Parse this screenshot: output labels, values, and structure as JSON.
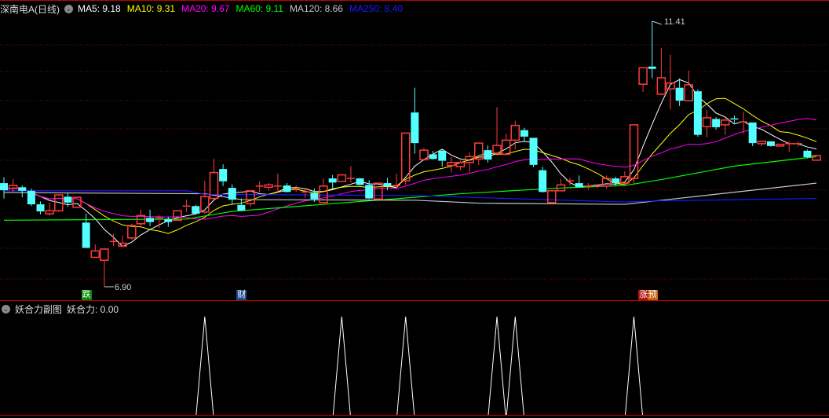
{
  "header": {
    "title": "深南电A(日线)",
    "ma": [
      {
        "label": "MA5: 9.18",
        "color": "#ffffff"
      },
      {
        "label": "MA10: 9.31",
        "color": "#ffff00"
      },
      {
        "label": "MA20: 9.67",
        "color": "#ff00ff"
      },
      {
        "label": "MA60: 9.11",
        "color": "#00ff00"
      },
      {
        "label": "MA120: 8.66",
        "color": "#c8c8c8"
      },
      {
        "label": "MA250: 8.40",
        "color": "#1a1aff"
      }
    ]
  },
  "sub_header": {
    "title": "妖合力副图",
    "value_label": "妖合力: 0.00"
  },
  "markers": {
    "high_label": "11.41",
    "low_label": "6.90",
    "signals": [
      {
        "index": 9,
        "text": "跌",
        "bg": "#0a8a0a"
      },
      {
        "index": 26,
        "text": "财",
        "bg": "#1a4a8a"
      },
      {
        "index": 70,
        "text": "涨",
        "bg": "#b01010"
      },
      {
        "index": 71,
        "text": "预",
        "bg": "#c86010"
      }
    ]
  },
  "colors": {
    "up": "#ff3b3b",
    "down": "#54ffff",
    "grid": "#6a0f0f",
    "divider": "#c00000"
  },
  "chart_data": {
    "type": "candlestick",
    "title": "深南电A(日线)",
    "ylim": [
      6.9,
      11.41
    ],
    "ohlc": [
      [
        8.66,
        8.76,
        8.4,
        8.54
      ],
      [
        8.57,
        8.73,
        8.49,
        8.62
      ],
      [
        8.59,
        8.62,
        8.42,
        8.53
      ],
      [
        8.53,
        8.57,
        8.27,
        8.3
      ],
      [
        8.3,
        8.35,
        8.13,
        8.18
      ],
      [
        8.14,
        8.33,
        8.11,
        8.19
      ],
      [
        8.19,
        8.46,
        8.17,
        8.46
      ],
      [
        8.43,
        8.5,
        8.26,
        8.33
      ],
      [
        8.25,
        8.42,
        8.25,
        8.42
      ],
      [
        7.99,
        8.14,
        7.56,
        7.56
      ],
      [
        7.4,
        7.62,
        7.4,
        7.51
      ],
      [
        7.35,
        7.56,
        6.9,
        7.54
      ],
      [
        7.67,
        7.8,
        7.59,
        7.67
      ],
      [
        7.59,
        7.77,
        7.57,
        7.64
      ],
      [
        7.73,
        7.97,
        7.7,
        7.94
      ],
      [
        7.97,
        8.21,
        7.9,
        8.11
      ],
      [
        8.07,
        8.21,
        7.93,
        8.0
      ],
      [
        8.05,
        8.11,
        7.9,
        8.07
      ],
      [
        8.05,
        8.09,
        7.92,
        8.0
      ],
      [
        8.03,
        8.19,
        8.02,
        8.19
      ],
      [
        8.25,
        8.38,
        8.17,
        8.27
      ],
      [
        8.27,
        8.29,
        8.13,
        8.14
      ],
      [
        8.17,
        8.7,
        8.14,
        8.43
      ],
      [
        8.4,
        9.07,
        8.4,
        8.84
      ],
      [
        8.9,
        8.98,
        8.61,
        8.69
      ],
      [
        8.58,
        8.64,
        8.3,
        8.38
      ],
      [
        8.29,
        8.4,
        8.19,
        8.19
      ],
      [
        8.31,
        8.53,
        8.26,
        8.53
      ],
      [
        8.61,
        8.69,
        8.5,
        8.61
      ],
      [
        8.59,
        8.66,
        8.53,
        8.63
      ],
      [
        8.61,
        8.82,
        8.5,
        8.61
      ],
      [
        8.62,
        8.66,
        8.5,
        8.51
      ],
      [
        8.57,
        8.62,
        8.51,
        8.57
      ],
      [
        8.49,
        8.57,
        8.41,
        8.51
      ],
      [
        8.49,
        8.57,
        8.34,
        8.39
      ],
      [
        8.33,
        8.74,
        8.33,
        8.61
      ],
      [
        8.74,
        8.8,
        8.57,
        8.67
      ],
      [
        8.69,
        8.8,
        8.69,
        8.8
      ],
      [
        8.74,
        8.95,
        8.67,
        8.74
      ],
      [
        8.74,
        8.75,
        8.62,
        8.63
      ],
      [
        8.63,
        8.71,
        8.39,
        8.4
      ],
      [
        8.39,
        8.66,
        8.39,
        8.66
      ],
      [
        8.66,
        8.75,
        8.54,
        8.61
      ],
      [
        8.62,
        8.82,
        8.57,
        8.62
      ],
      [
        8.7,
        9.51,
        8.63,
        9.51
      ],
      [
        9.86,
        10.28,
        9.16,
        9.34
      ],
      [
        9.06,
        9.26,
        9.04,
        9.22
      ],
      [
        9.15,
        9.21,
        9.06,
        9.07
      ],
      [
        9.21,
        9.23,
        8.94,
        9.04
      ],
      [
        8.96,
        9.1,
        8.84,
        9.01
      ],
      [
        8.94,
        9.04,
        8.88,
        9.01
      ],
      [
        9.01,
        9.18,
        8.84,
        9.11
      ],
      [
        9.07,
        9.34,
        8.97,
        9.34
      ],
      [
        9.22,
        9.3,
        9.01,
        9.06
      ],
      [
        9.17,
        9.95,
        9.13,
        9.3
      ],
      [
        9.15,
        9.5,
        9.13,
        9.39
      ],
      [
        9.39,
        9.72,
        9.23,
        9.64
      ],
      [
        9.56,
        9.6,
        9.37,
        9.45
      ],
      [
        9.43,
        9.43,
        8.93,
        8.97
      ],
      [
        8.88,
        8.94,
        8.5,
        8.51
      ],
      [
        8.33,
        8.53,
        8.33,
        8.53
      ],
      [
        8.53,
        8.73,
        8.53,
        8.63
      ],
      [
        8.7,
        8.75,
        8.62,
        8.7
      ],
      [
        8.66,
        8.79,
        8.59,
        8.59
      ],
      [
        8.61,
        8.66,
        8.55,
        8.61
      ],
      [
        8.59,
        8.63,
        8.57,
        8.61
      ],
      [
        8.61,
        8.79,
        8.57,
        8.74
      ],
      [
        8.74,
        8.77,
        8.62,
        8.66
      ],
      [
        8.66,
        8.86,
        8.62,
        8.77
      ],
      [
        8.74,
        9.65,
        8.63,
        9.65
      ],
      [
        10.34,
        10.62,
        10.21,
        10.62
      ],
      [
        10.64,
        11.41,
        10.44,
        10.6
      ],
      [
        10.17,
        10.96,
        10.17,
        10.45
      ],
      [
        10.26,
        10.84,
        9.91,
        10.36
      ],
      [
        10.28,
        10.44,
        9.97,
        10.06
      ],
      [
        10.06,
        10.57,
        10.06,
        10.33
      ],
      [
        10.22,
        10.25,
        9.45,
        9.48
      ],
      [
        9.62,
        9.9,
        9.44,
        9.77
      ],
      [
        9.75,
        9.78,
        9.57,
        9.61
      ],
      [
        9.65,
        9.79,
        9.48,
        9.73
      ],
      [
        9.75,
        9.81,
        9.68,
        9.73
      ],
      [
        9.68,
        9.87,
        9.5,
        9.7
      ],
      [
        9.69,
        9.69,
        9.29,
        9.34
      ],
      [
        9.33,
        9.37,
        9.29,
        9.37
      ],
      [
        9.37,
        9.37,
        9.28,
        9.29
      ],
      [
        9.29,
        9.32,
        9.29,
        9.32
      ],
      [
        9.33,
        9.37,
        9.19,
        9.33
      ],
      [
        9.33,
        9.37,
        9.28,
        9.33
      ],
      [
        9.21,
        9.23,
        9.08,
        9.1
      ],
      [
        9.05,
        9.13,
        9.05,
        9.13
      ]
    ],
    "ma_computed": [
      {
        "name": "MA5",
        "period": 5,
        "color": "#ffffff"
      },
      {
        "name": "MA10",
        "period": 10,
        "color": "#ffff00"
      },
      {
        "name": "MA20",
        "period": 20,
        "color": "#ff00ff"
      }
    ],
    "ma_keypoints": [
      {
        "name": "MA60",
        "color": "#00ff00",
        "points": [
          [
            0,
            8.03
          ],
          [
            20,
            8.05
          ],
          [
            25,
            8.18
          ],
          [
            35,
            8.3
          ],
          [
            50,
            8.48
          ],
          [
            60,
            8.57
          ],
          [
            68,
            8.62
          ],
          [
            72,
            8.72
          ],
          [
            80,
            8.95
          ],
          [
            89,
            9.11
          ]
        ]
      },
      {
        "name": "MA120",
        "color": "#c8c8c8",
        "points": [
          [
            0,
            8.5
          ],
          [
            22,
            8.48
          ],
          [
            26,
            8.38
          ],
          [
            45,
            8.37
          ],
          [
            52,
            8.32
          ],
          [
            68,
            8.3
          ],
          [
            75,
            8.42
          ],
          [
            89,
            8.66
          ]
        ]
      },
      {
        "name": "MA250",
        "color": "#1a1aff",
        "points": [
          [
            0,
            8.53
          ],
          [
            20,
            8.53
          ],
          [
            22,
            8.47
          ],
          [
            45,
            8.45
          ],
          [
            55,
            8.4
          ],
          [
            68,
            8.34
          ],
          [
            72,
            8.36
          ],
          [
            89,
            8.4
          ]
        ]
      }
    ],
    "sub_indicator": {
      "name": "妖合力",
      "signal_indices": [
        22,
        37,
        44,
        54,
        56,
        69
      ]
    }
  }
}
